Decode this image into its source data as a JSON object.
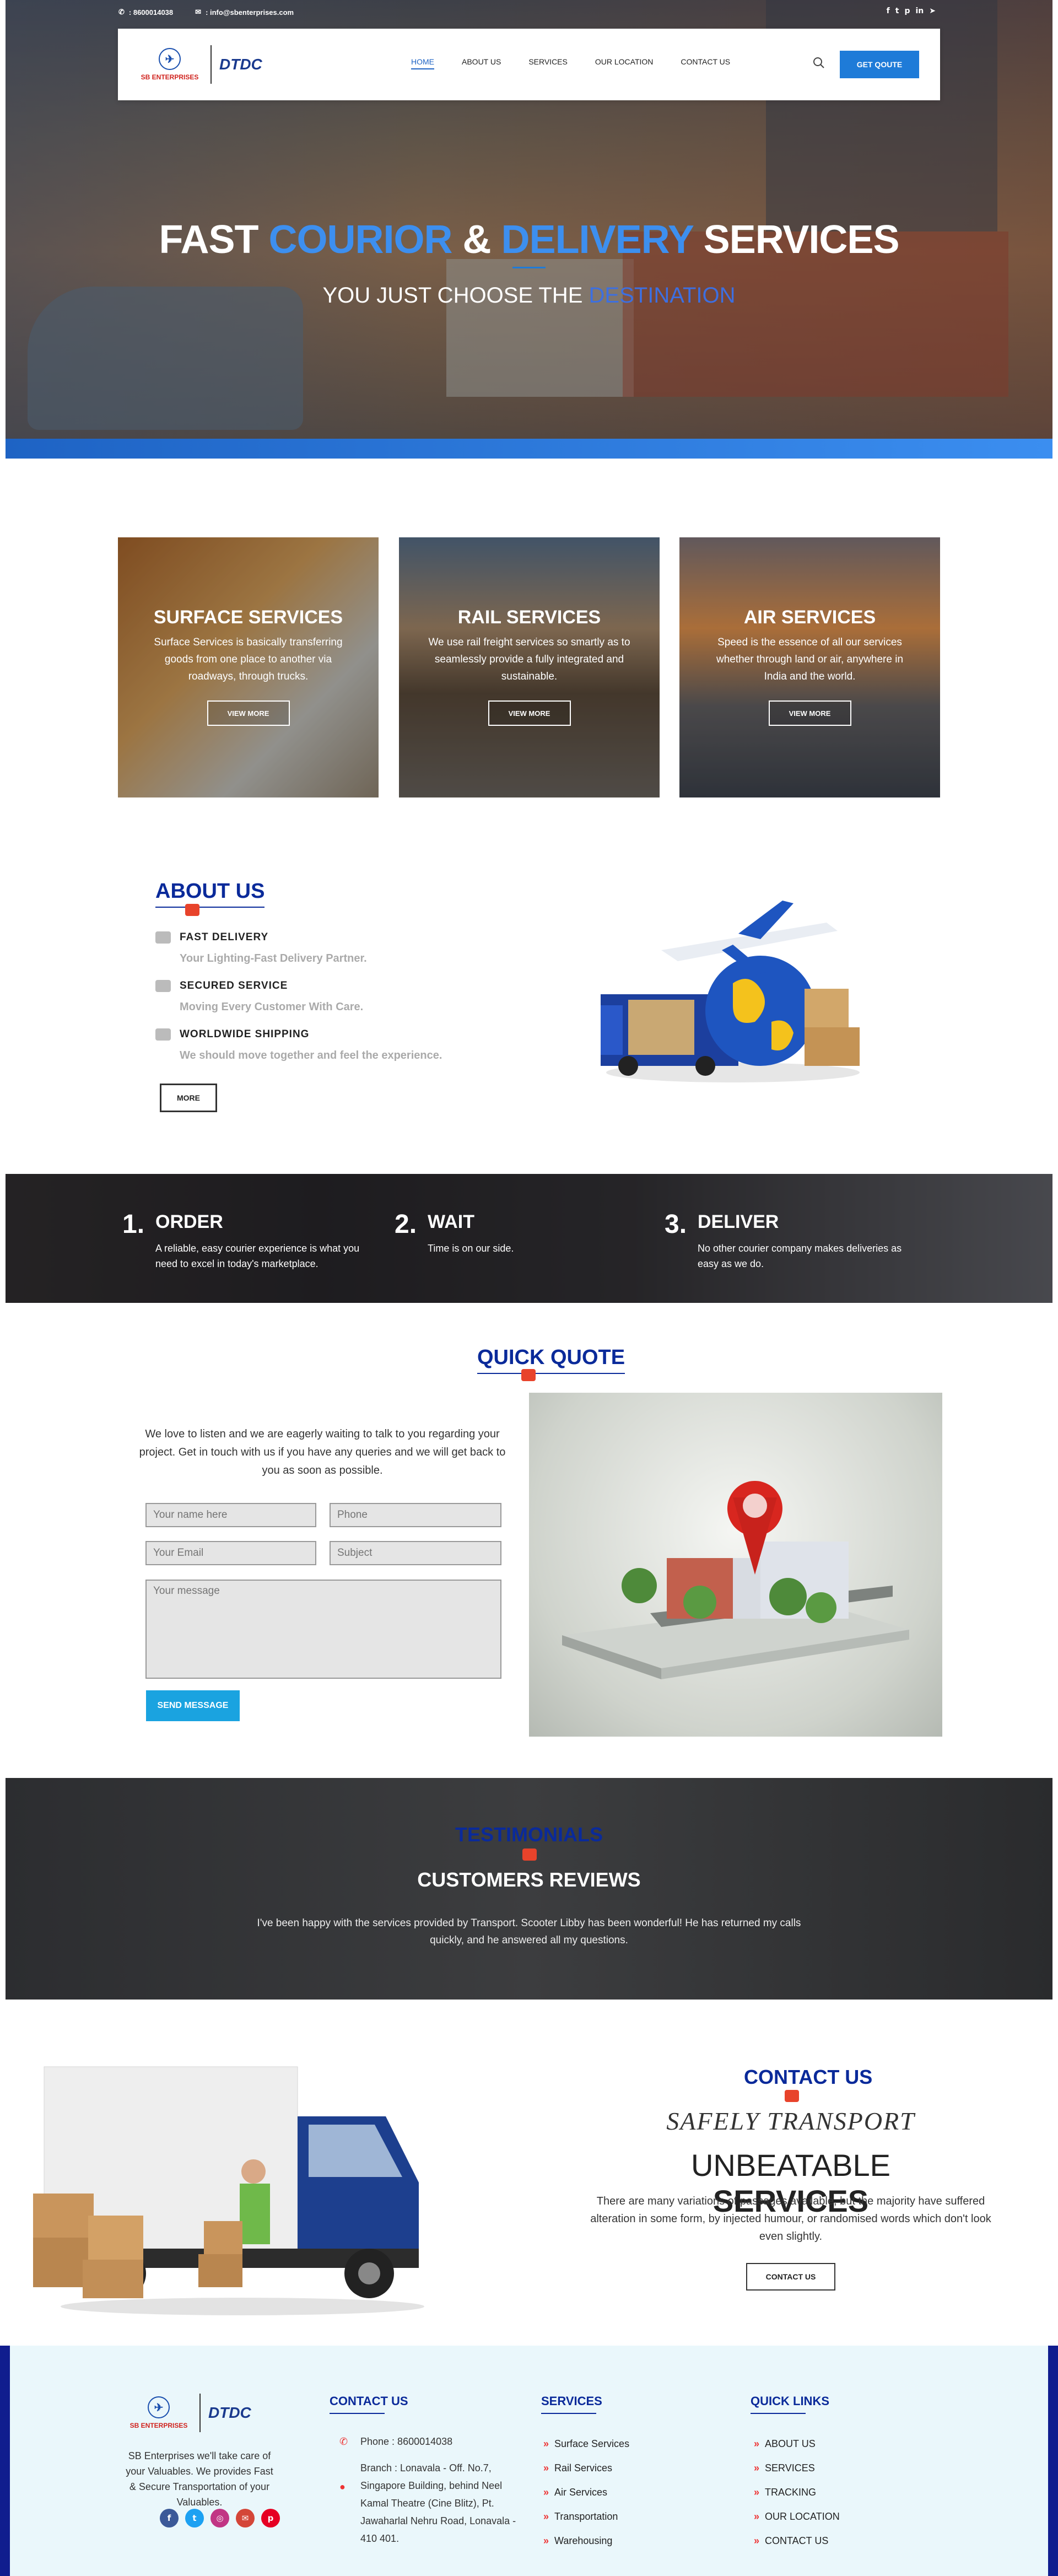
{
  "topbar": {
    "phone": ": 8600014038",
    "email": ": info@sbenterprises.com"
  },
  "social_icons": [
    "facebook-icon",
    "twitter-icon",
    "pinterest-icon",
    "linkedin-icon",
    "telegram-icon"
  ],
  "logo": {
    "company": "SB ENTERPRISES",
    "partner": "DTDC"
  },
  "nav": {
    "items": [
      "HOME",
      "ABOUT US",
      "SERVICES",
      "OUR LOCATION",
      "CONTACT US"
    ],
    "cta": "GET QOUTE"
  },
  "hero": {
    "title_a": "FAST ",
    "title_b": "COURIOR",
    "title_c": " & ",
    "title_d": "DELIVERY",
    "title_e": " SERVICES",
    "sub_a": "YOU JUST CHOOSE THE ",
    "sub_b": "DESTINATION"
  },
  "services": [
    {
      "title": "SURFACE SERVICES",
      "text": "Surface Services is basically transferring goods from one place to another via roadways, through trucks.",
      "button": "VIEW MORE"
    },
    {
      "title": "RAIL SERVICES",
      "text": "We use rail freight services so smartly as to seamlessly provide a fully integrated and sustainable.",
      "button": "VIEW MORE"
    },
    {
      "title": "AIR SERVICES",
      "text": "Speed is the essence of all our services whether through land or air, anywhere in India and the world.",
      "button": "VIEW MORE"
    }
  ],
  "about": {
    "title": "ABOUT US",
    "items": [
      {
        "title": "FAST DELIVERY",
        "text": "Your Lighting-Fast Delivery Partner."
      },
      {
        "title": "SECURED SERVICE",
        "text": "Moving Every Customer With Care."
      },
      {
        "title": "WORLDWIDE SHIPPING",
        "text": "We should move together and feel the experience."
      }
    ],
    "button": "MORE"
  },
  "steps": [
    {
      "num": "1.",
      "title": "ORDER",
      "text": "A reliable, easy courier experience is what you need to excel in today's marketplace."
    },
    {
      "num": "2.",
      "title": "WAIT",
      "text": "Time is on our side."
    },
    {
      "num": "3.",
      "title": "DELIVER",
      "text": "No other courier company makes deliveries as easy as we do."
    }
  ],
  "quote": {
    "title": "QUICK QUOTE",
    "text": "We love to listen and we are eagerly waiting to talk to you regarding your project. Get in touch with us if you have any queries and we will get back to you as soon as possible.",
    "name_placeholder": "Your name here",
    "phone_placeholder": "Phone",
    "email_placeholder": "Your Email",
    "subject_placeholder": "Subject",
    "message_placeholder": "Your message",
    "button": "SEND MESSAGE"
  },
  "testimonials": {
    "title": "TESTIMONIALS",
    "subtitle": "CUSTOMERS REVIEWS",
    "text": "I've been happy with the services provided by Transport. Scooter Libby has been wonderful! He has returned my calls quickly, and he answered all my questions."
  },
  "contact": {
    "title": "CONTACT US",
    "line1": "SAFELY TRANSPORT",
    "line2_a": "UNBEATABLE ",
    "line2_b": "SERVICES",
    "text": "There are many variations of passages available, but the majority have suffered alteration in some form, by injected humour, or randomised words which don't look even slightly.",
    "button": "CONTACT US"
  },
  "footer": {
    "about": "SB Enterprises we'll take care of your Valuables. We provides Fast & Secure Transportation of your Valuables.",
    "contact_title": "CONTACT US",
    "phone": "Phone : 8600014038",
    "address": "Branch : Lonavala - Off. No.7, Singapore Building, behind Neel Kamal Theatre (Cine Blitz), Pt. Jawaharlal Nehru Road, Lonavala - 410 401.",
    "services_title": "SERVICES",
    "services": [
      "Surface Services",
      "Rail Services",
      "Air Services",
      "Transportation",
      "Warehousing"
    ],
    "links_title": "QUICK LINKS",
    "links": [
      "ABOUT US",
      "SERVICES",
      "TRACKING",
      "OUR LOCATION",
      "CONTACT US"
    ],
    "social_icons": [
      "facebook-icon",
      "twitter-icon",
      "instagram-icon",
      "mail-icon",
      "pinterest-icon"
    ]
  }
}
